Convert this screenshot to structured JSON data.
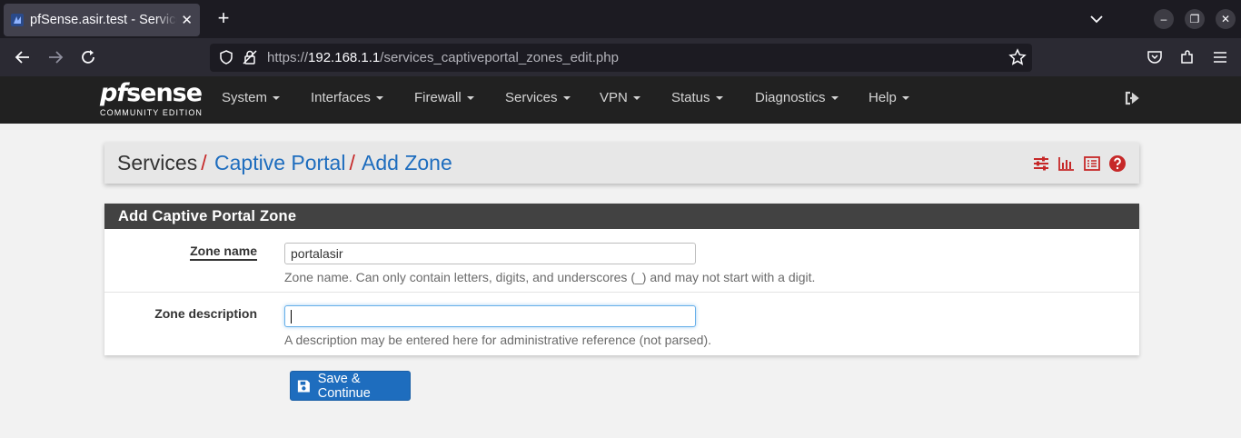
{
  "browser": {
    "tab_title": "pfSense.asir.test - Services: Captive Portal: Add Zone",
    "tab_close": "✕",
    "newtab": "+",
    "url_scheme": "https://",
    "url_host": "192.168.1.1",
    "url_path": "/services_captiveportal_zones_edit.php",
    "window_minimize": "–",
    "window_restore": "❐",
    "window_close": "✕"
  },
  "header": {
    "logo_prefix": "pf",
    "logo_main": "sense",
    "logo_edition": "COMMUNITY EDITION",
    "menu": [
      "System",
      "Interfaces",
      "Firewall",
      "Services",
      "VPN",
      "Status",
      "Diagnostics",
      "Help"
    ]
  },
  "breadcrumb": {
    "root": "Services",
    "level1": "Captive Portal",
    "level2": "Add Zone",
    "separator": "/"
  },
  "panel": {
    "title": "Add Captive Portal Zone",
    "zone_name_label": "Zone name",
    "zone_name_value": "portalasir",
    "zone_name_help": "Zone name. Can only contain letters, digits, and underscores (_) and may not start with a digit.",
    "zone_desc_label": "Zone description",
    "zone_desc_value": "",
    "zone_desc_help": "A description may be entered here for administrative reference (not parsed)."
  },
  "actions": {
    "save_label": "Save & Continue"
  },
  "colors": {
    "accent_blue": "#1e6dbe",
    "breadcrumb_separator_red": "#c62828",
    "header_bg": "#212121"
  }
}
